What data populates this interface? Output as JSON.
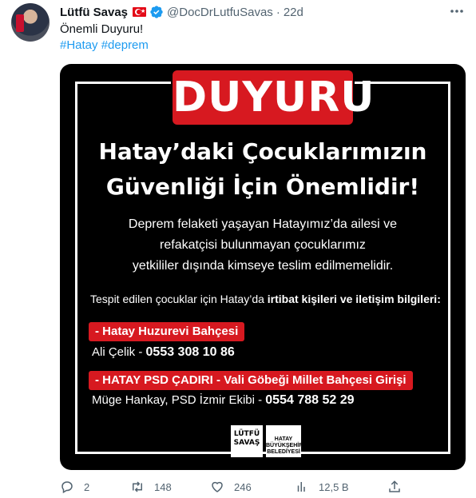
{
  "tweet": {
    "author_name": "Lütfü Savaş",
    "handle": "@DocDrLutfuSavas",
    "separator": "·",
    "time": "22d",
    "text": "Önemli Duyuru!",
    "hashtags": "#Hatay #deprem"
  },
  "media": {
    "banner": "DUYURU",
    "heading_line1": "Hatay’daki Çocuklarımızın",
    "heading_line2": "Güvenliği İçin Önemlidir!",
    "para_line1": "Deprem felaketi yaşayan Hatayımız’da ailesi ve",
    "para_line2": "refakatçisi bulunmayan çocuklarımız",
    "para_line3": "yetkililer dışında kimseye teslim edilmemelidir.",
    "tespit_prefix": "Tespit edilen çocuklar için Hatay’da ",
    "tespit_bold": "irtibat kişileri ve iletişim bilgileri:",
    "location1": "- Hatay Huzurevi Bahçesi",
    "contact1_name": "Ali Çelik - ",
    "contact1_phone": "0553 308 10 86",
    "location2": "- HATAY PSD ÇADIRI - Vali Göbeği Millet Bahçesi Girişi",
    "contact2_name": "Müge Hankay, PSD İzmir Ekibi - ",
    "contact2_phone": "0554 788 52 29",
    "logo_left": "LÜTFÜ SAVAŞ",
    "logo_right": "HATAY BÜYÜKŞEHİR BELEDİYESİ"
  },
  "actions": {
    "replies": "2",
    "retweets": "148",
    "likes": "246",
    "views": "12,5 B"
  },
  "icons": {
    "verified": "verified-badge-icon",
    "more": "more-icon",
    "reply": "reply-icon",
    "retweet": "retweet-icon",
    "like": "heart-icon",
    "views": "views-icon",
    "share": "share-icon"
  },
  "colors": {
    "link": "#1d9bf0",
    "secondary_text": "#536471",
    "banner_red": "#d71920"
  }
}
